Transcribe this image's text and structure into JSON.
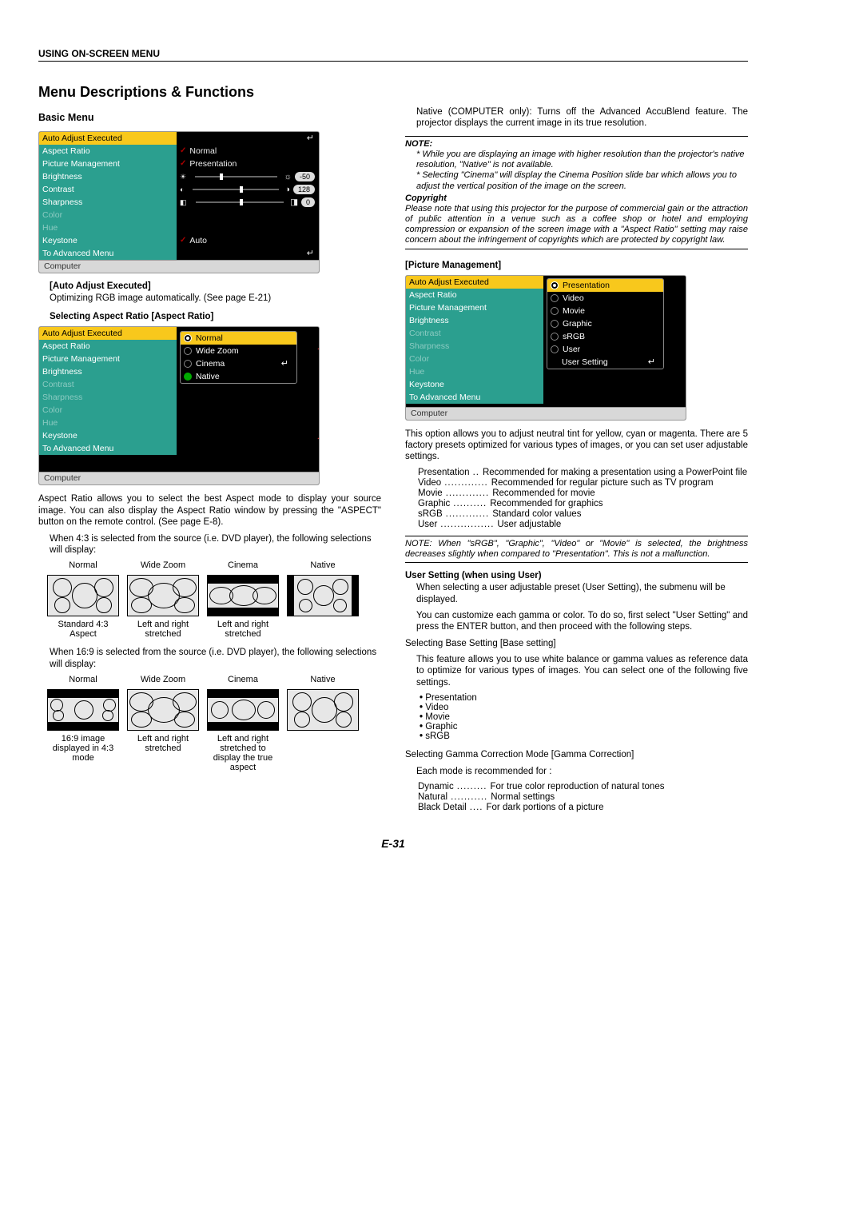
{
  "header": "USING ON-SCREEN MENU",
  "title": "Menu Descriptions & Functions",
  "basic_menu": "Basic Menu",
  "menu1": {
    "items": [
      "Auto Adjust Executed",
      "Aspect Ratio",
      "Picture Management",
      "Brightness",
      "Contrast",
      "Sharpness",
      "Color",
      "Hue",
      "Keystone",
      "To Advanced Menu"
    ],
    "aspect_val": "Normal",
    "pict_val": "Presentation",
    "keystone_val": "Auto",
    "brightness": "-50",
    "contrast": "128",
    "sharpness": "0",
    "footer": "Computer"
  },
  "auto_adjust_h": "Auto Adjust Executed",
  "auto_adjust_p": "Optimizing RGB image automatically. (See page E-21)",
  "sel_aspect_h": "Selecting Aspect Ratio [Aspect Ratio]",
  "menu2_sub": [
    "Normal",
    "Wide Zoom",
    "Cinema",
    "Native"
  ],
  "aspect_p": "Aspect Ratio allows you to select the best Aspect mode to display your source image. You can also display the Aspect Ratio window by pressing the \"ASPECT\" button on the remote control. (See page E-8).",
  "when43": "When 4:3 is selected from the source (i.e. DVD player), the following selections will display:",
  "when169": "When 16:9 is selected from the source (i.e. DVD player), the following selections will display:",
  "labels43": {
    "top": [
      "Normal",
      "Wide Zoom",
      "Cinema",
      "Native"
    ],
    "bottom": [
      "Standard 4:3 Aspect",
      "Left and right stretched",
      "Left and right stretched",
      ""
    ]
  },
  "labels169": {
    "top": [
      "Normal",
      "Wide Zoom",
      "Cinema",
      "Native"
    ],
    "bottom": [
      "16:9 image displayed in 4:3 mode",
      "Left and right stretched",
      "Left and right stretched to display the true aspect",
      ""
    ]
  },
  "rcol": {
    "native_p": "Native (COMPUTER only): Turns off the Advanced AccuBlend feature. The projector displays the current image in its true resolution.",
    "note_label": "NOTE:",
    "note1": "* While you are displaying an image with higher resolution than the projector's native resolution, \"Native\" is not available.",
    "note2": "* Selecting \"Cinema\" will display the Cinema Position slide bar which allows you to adjust the vertical position of the image on the screen.",
    "copyright_label": "Copyright",
    "copyright_p": "Please note that using this projector for the purpose of commercial gain or the attraction of public attention in a venue such as a coffee shop or hotel and employing compression or expansion of the screen image with a \"Aspect Ratio\" setting may raise concern about the infringement of copyrights which are protected by copyright law.",
    "pm_h": "[Picture Management]",
    "pm_sub": [
      "Presentation",
      "Video",
      "Movie",
      "Graphic",
      "sRGB",
      "User",
      "User Setting"
    ],
    "pm_p": "This option allows you to adjust neutral tint for yellow, cyan or magenta. There are 5 factory presets optimized for various types of images, or you can set user adjustable settings.",
    "pm_list": [
      {
        "t": "Presentation",
        "d": "Recommended for making a presentation using a PowerPoint file"
      },
      {
        "t": "Video",
        "d": "Recommended for regular picture such as TV program"
      },
      {
        "t": "Movie",
        "d": "Recommended for movie"
      },
      {
        "t": "Graphic",
        "d": "Recommended for graphics"
      },
      {
        "t": "sRGB",
        "d": "Standard color values"
      },
      {
        "t": "User",
        "d": "User adjustable"
      }
    ],
    "pm_note": "NOTE: When \"sRGB\", \"Graphic\", \"Video\" or \"Movie\" is selected, the brightness decreases slightly when compared to \"Presentation\". This is not a malfunction.",
    "us_h": "User Setting (when using User)",
    "us_p1": "When selecting a user adjustable preset (User Setting), the submenu will be displayed.",
    "us_p2": "You can customize each gamma or color. To do so, first select \"User Setting\" and press the ENTER button, and then proceed with the following steps.",
    "bs_h": "Selecting Base Setting [Base setting]",
    "bs_p": "This feature allows you to use white balance or gamma values as reference data to optimize for various types of images. You can select one of the following five settings.",
    "bs_list": [
      "Presentation",
      "Video",
      "Movie",
      "Graphic",
      "sRGB"
    ],
    "gc_h": "Selecting Gamma Correction Mode [Gamma Correction]",
    "gc_p": "Each mode is recommended for :",
    "gc_list": [
      {
        "t": "Dynamic",
        "d": "For true color reproduction of natural tones"
      },
      {
        "t": "Natural",
        "d": "Normal settings"
      },
      {
        "t": "Black Detail",
        "d": "For dark portions of a picture"
      }
    ]
  },
  "page": "E-31"
}
